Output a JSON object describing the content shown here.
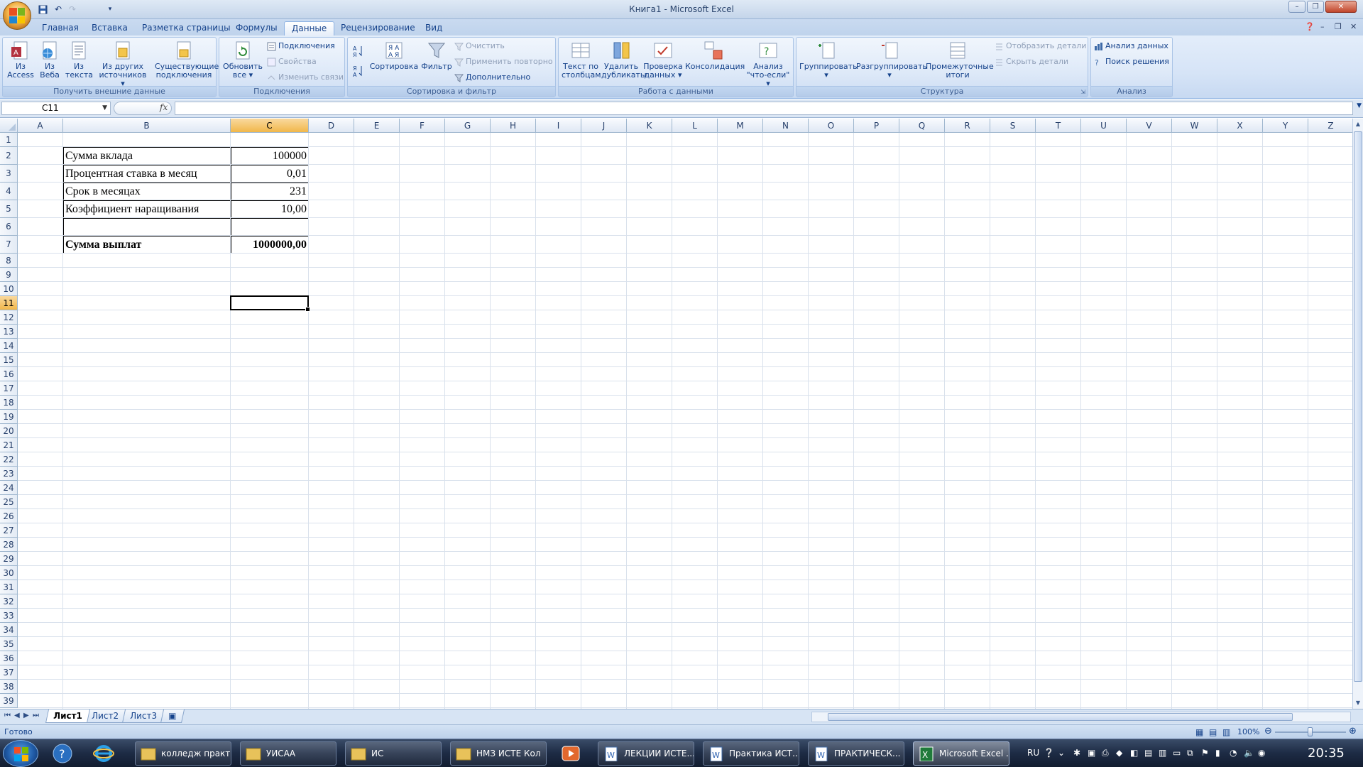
{
  "window": {
    "title": "Книга1 - Microsoft Excel",
    "min_label": "–",
    "restore_label": "❐",
    "close_label": "✕"
  },
  "ribbon_tabs": [
    "Главная",
    "Вставка",
    "Разметка страницы",
    "Формулы",
    "Данные",
    "Рецензирование",
    "Вид"
  ],
  "active_tab": "Данные",
  "ribbon": {
    "external": {
      "caption": "Получить внешние данные",
      "access": [
        "Из",
        "Access"
      ],
      "web": [
        "Из",
        "Веба"
      ],
      "text": [
        "Из",
        "текста"
      ],
      "other": [
        "Из других",
        "источников"
      ],
      "existing": [
        "Существующие",
        "подключения"
      ]
    },
    "connections": {
      "caption": "Подключения",
      "refresh": [
        "Обновить",
        "все"
      ],
      "conn": "Подключения",
      "props": "Свойства",
      "edit_links": "Изменить связи"
    },
    "sort": {
      "caption": "Сортировка и фильтр",
      "sort": "Сортировка",
      "filter": "Фильтр",
      "clear": "Очистить",
      "reapply": "Применить повторно",
      "advanced": "Дополнительно"
    },
    "datatools": {
      "caption": "Работа с данными",
      "text_to_cols": [
        "Текст по",
        "столбцам"
      ],
      "remove_dup": [
        "Удалить",
        "дубликаты"
      ],
      "validation": [
        "Проверка",
        "данных"
      ],
      "consolidate": "Консолидация",
      "whatif": [
        "Анализ",
        "\"что-если\""
      ]
    },
    "outline": {
      "caption": "Структура",
      "group": "Группировать",
      "ungroup": "Разгруппировать",
      "subtotal": [
        "Промежуточные",
        "итоги"
      ],
      "show": "Отобразить детали",
      "hide": "Скрыть детали"
    },
    "analysis": {
      "caption": "Анализ",
      "data_analysis": "Анализ данных",
      "solver": "Поиск решения"
    }
  },
  "formula_bar": {
    "name_box": "C11",
    "fx": "fx",
    "formula": ""
  },
  "columns": [
    "A",
    "B",
    "C",
    "D",
    "E",
    "F",
    "G",
    "H",
    "I",
    "J",
    "K",
    "L",
    "M",
    "N",
    "O",
    "P",
    "Q",
    "R",
    "S",
    "T",
    "U",
    "V",
    "W",
    "X",
    "Y",
    "Z"
  ],
  "selected_column": "C",
  "rows_visible": 39,
  "selected_row": 11,
  "sheet": {
    "b2": "Сумма вклада",
    "c2": "100000",
    "b3": "Процентная ставка в месяц",
    "c3": "0,01",
    "b4": "Срок в месяцах",
    "c4": "231",
    "b5": "Коэффициент наращивания",
    "c5": "10,00",
    "b7": "Сумма выплат",
    "c7": "1000000,00"
  },
  "sheet_tabs": [
    "Лист1",
    "Лист2",
    "Лист3"
  ],
  "active_sheet": "Лист1",
  "status": {
    "text": "Готово",
    "zoom": "100%"
  },
  "taskbar": {
    "items": [
      "колледж практ...",
      "УИСАА",
      "ИС",
      "НМЗ ИСТЕ Кол",
      "ЛЕКЦИИ ИСТЕ...",
      "Практика ИСТ...",
      "ПРАКТИЧЕСК...",
      "Microsoft Excel ..."
    ],
    "lang": "RU",
    "clock": "20:35"
  },
  "colors": {
    "accent": "#15428b",
    "selection": "#f1b74a",
    "ribbon": "#d6e4f7"
  }
}
